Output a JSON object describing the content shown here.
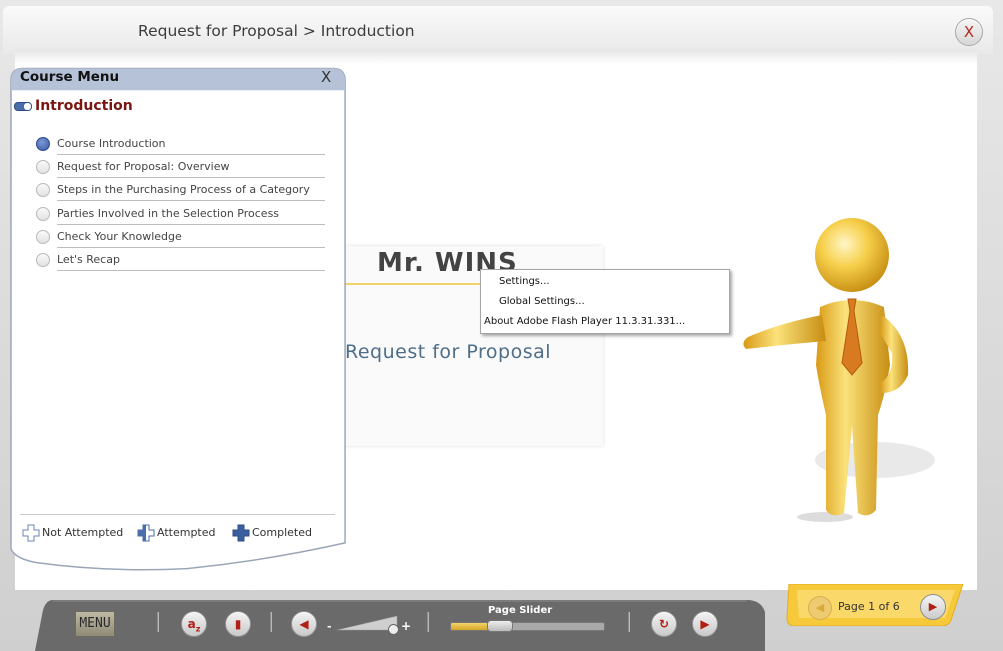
{
  "header": {
    "title": "Request for Proposal > Introduction",
    "close_label": "X"
  },
  "slide": {
    "title": "Mr. WINS",
    "subtitle": "Request for Proposal"
  },
  "course_menu": {
    "header": "Course Menu",
    "close_label": "X",
    "section_title": "Introduction",
    "items": [
      {
        "label": "Course Introduction",
        "status": "current"
      },
      {
        "label": "Request for Proposal: Overview",
        "status": "not-attempted"
      },
      {
        "label": "Steps in the Purchasing Process of a Category",
        "status": "not-attempted"
      },
      {
        "label": "Parties Involved in the Selection Process",
        "status": "not-attempted"
      },
      {
        "label": "Check Your Knowledge",
        "status": "not-attempted"
      },
      {
        "label": "Let's Recap",
        "status": "not-attempted"
      }
    ],
    "legend": [
      {
        "label": "Not Attempted",
        "color": "#ffffff"
      },
      {
        "label": "Attempted",
        "color": "#4a6ea8"
      },
      {
        "label": "Completed",
        "color": "#3c5fa0"
      }
    ]
  },
  "context_menu": {
    "items": [
      "Settings...",
      "Global Settings...",
      "About Adobe Flash Player 11.3.31.331..."
    ]
  },
  "toolbar": {
    "menu_label": "MENU",
    "page_slider_label": "Page Slider",
    "volume_minus": "-",
    "volume_plus": "+",
    "page_progress": 0.3
  },
  "pager": {
    "page_text": "Page 1 of 6"
  },
  "colors": {
    "accent_blue": "#4a6ea8",
    "section_red": "#7a1612",
    "gold": "#f2c23e",
    "toolbar_gray": "#6a6a6a"
  }
}
